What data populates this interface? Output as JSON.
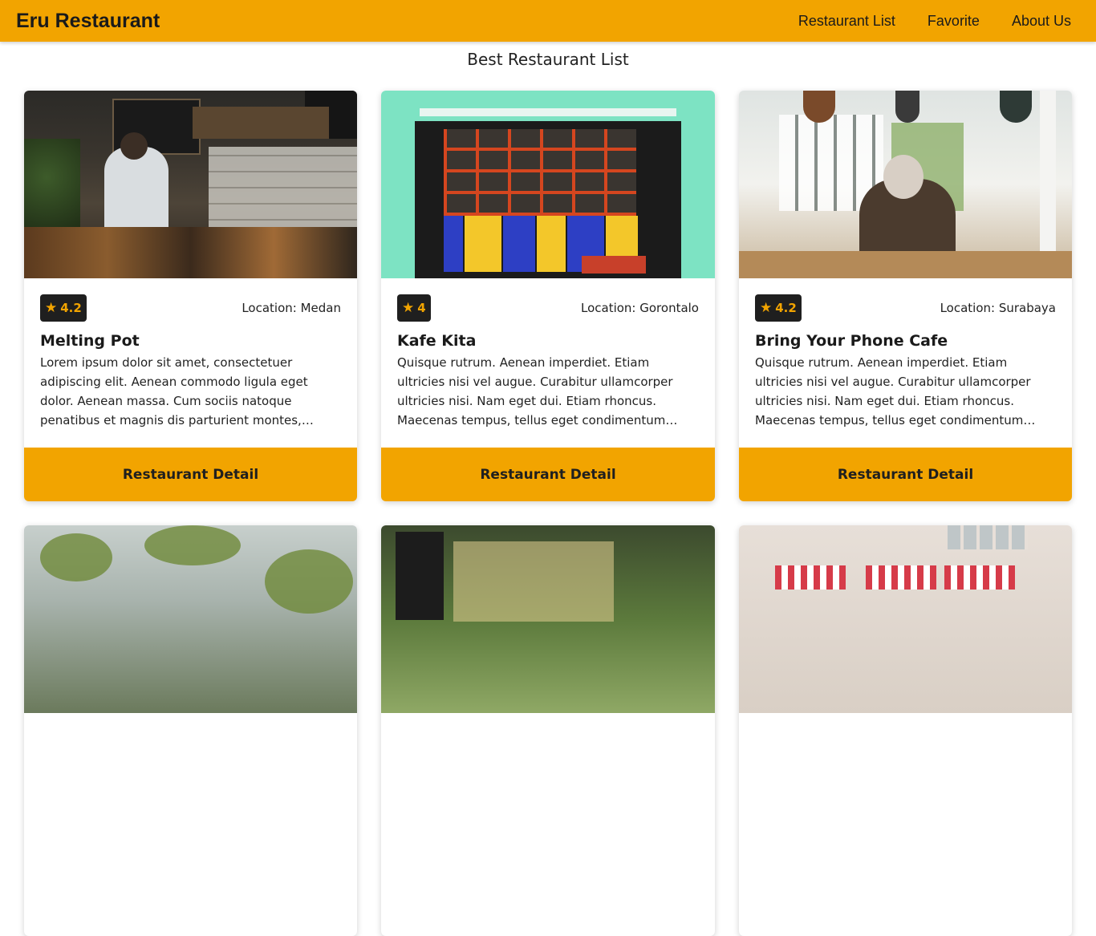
{
  "navbar": {
    "brand": "Eru Restaurant",
    "links": [
      "Restaurant List",
      "Favorite",
      "About Us"
    ]
  },
  "page_title": "Best Restaurant List",
  "restaurants": [
    {
      "name": "Melting Pot",
      "rating": "4.2",
      "location": "Location: Medan",
      "description": "Lorem ipsum dolor sit amet, consectetuer adipiscing elit. Aenean commodo ligula eget dolor. Aenean massa. Cum sociis natoque penatibus et magnis dis parturient montes, nascetur ridiculus mus.",
      "button": "Restaurant Detail"
    },
    {
      "name": "Kafe Kita",
      "rating": "4",
      "location": "Location: Gorontalo",
      "description": "Quisque rutrum. Aenean imperdiet. Etiam ultricies nisi vel augue. Curabitur ullamcorper ultricies nisi. Nam eget dui. Etiam rhoncus. Maecenas tempus, tellus eget condimentum rhoncus.",
      "button": "Restaurant Detail"
    },
    {
      "name": "Bring Your Phone Cafe",
      "rating": "4.2",
      "location": "Location: Surabaya",
      "description": "Quisque rutrum. Aenean imperdiet. Etiam ultricies nisi vel augue. Curabitur ullamcorper ultricies nisi. Nam eget dui. Etiam rhoncus. Maecenas tempus, tellus eget condimentum rhoncus.",
      "button": "Restaurant Detail"
    }
  ],
  "colors": {
    "accent": "#f2a400",
    "rating_bg": "#1f1f1f"
  },
  "icons": {
    "rating": "star-icon"
  }
}
